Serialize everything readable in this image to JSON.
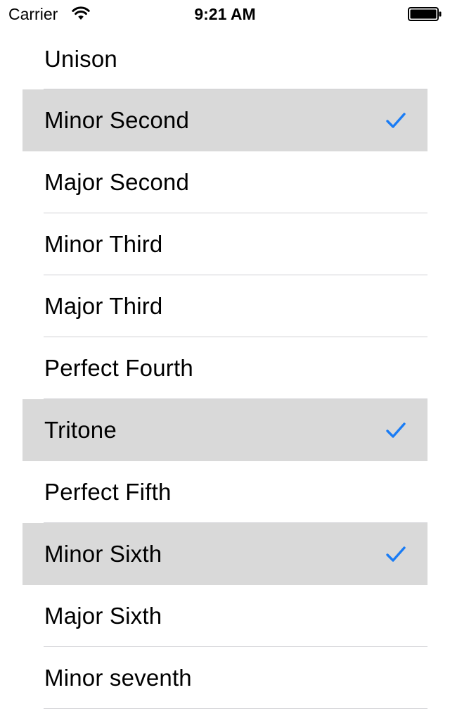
{
  "status_bar": {
    "carrier": "Carrier",
    "time": "9:21 AM",
    "wifi_icon": "wifi-icon",
    "battery_icon": "battery-icon"
  },
  "accent_color": "#1a7cf5",
  "selected_row_color": "#d9d9d9",
  "intervals": [
    {
      "label": "Unison",
      "selected": false
    },
    {
      "label": "Minor Second",
      "selected": true
    },
    {
      "label": "Major Second",
      "selected": false
    },
    {
      "label": "Minor Third",
      "selected": false
    },
    {
      "label": "Major Third",
      "selected": false
    },
    {
      "label": "Perfect Fourth",
      "selected": false
    },
    {
      "label": "Tritone",
      "selected": true
    },
    {
      "label": "Perfect Fifth",
      "selected": false
    },
    {
      "label": "Minor Sixth",
      "selected": true
    },
    {
      "label": "Major Sixth",
      "selected": false
    },
    {
      "label": "Minor seventh",
      "selected": false
    }
  ]
}
